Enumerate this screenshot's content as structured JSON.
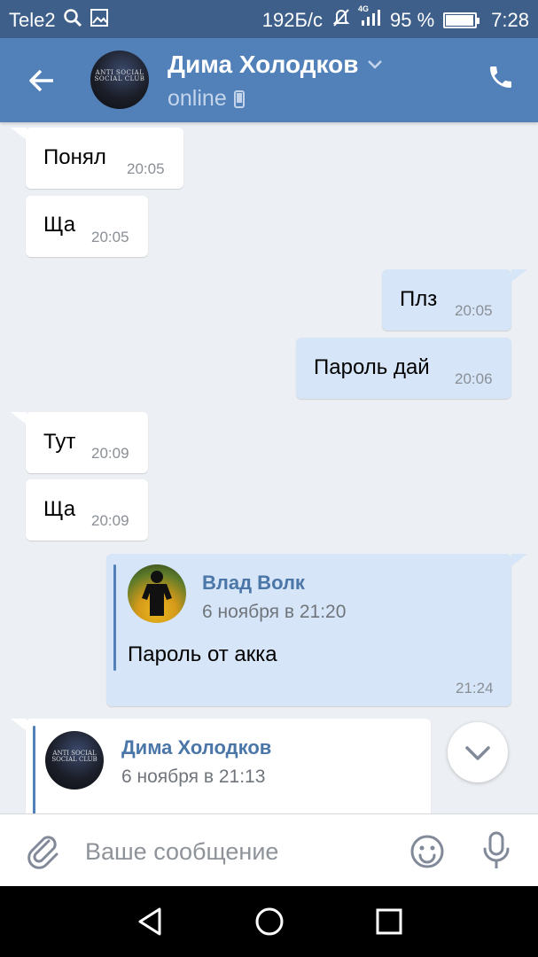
{
  "status_bar": {
    "carrier": "Tele2",
    "speed": "192Б/с",
    "network": "4G",
    "battery_text": "95 %",
    "battery_level": 0.95,
    "time": "7:28"
  },
  "header": {
    "contact_name": "Дима Холодков",
    "status": "online",
    "avatar_text": "ANTI SOCIAL SOCIAL CLUB"
  },
  "messages": [
    {
      "dir": "in",
      "text": "Понял",
      "time": "20:05"
    },
    {
      "dir": "in",
      "text": "Ща",
      "time": "20:05"
    },
    {
      "dir": "out",
      "text": "Плз",
      "time": "20:05"
    },
    {
      "dir": "out",
      "text": "Пароль дай",
      "time": "20:06"
    },
    {
      "dir": "in",
      "text": "Тут",
      "time": "20:09"
    },
    {
      "dir": "in",
      "text": "Ща",
      "time": "20:09"
    }
  ],
  "forwarded_out": {
    "author": "Влад Волк",
    "date": "6 ноября в 21:20",
    "text": "Пароль от акка",
    "time": "21:24"
  },
  "forwarded_in": {
    "author": "Дима Холодков",
    "date": "6 ноября в 21:13",
    "avatar_text": "ANTI SOCIAL SOCIAL CLUB"
  },
  "input": {
    "placeholder": "Ваше сообщение",
    "value": ""
  },
  "colors": {
    "header": "#5181b8",
    "status_bar": "#3d5f89",
    "background": "#eceff3",
    "outgoing_bubble": "#d6e5f7",
    "link": "#4a76a8"
  },
  "icons": [
    "back-arrow-icon",
    "chevron-down-icon",
    "mobile-icon",
    "phone-icon",
    "paperclip-icon",
    "smile-icon",
    "mic-icon",
    "nav-back-icon",
    "nav-home-icon",
    "nav-recents-icon"
  ]
}
